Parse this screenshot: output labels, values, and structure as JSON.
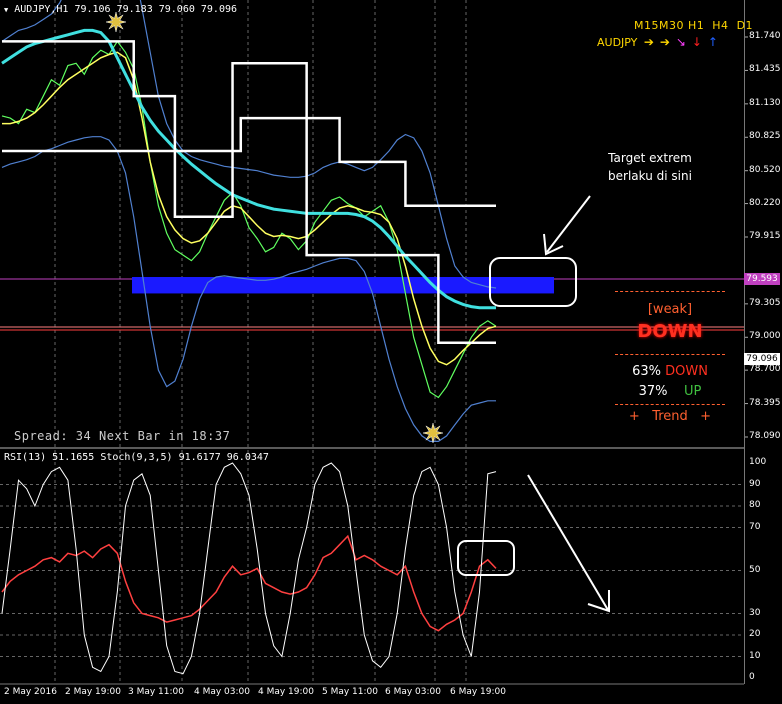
{
  "header": {
    "symbol_info": "AUDJPY,H1  79.106 79.183 79.060 79.096",
    "indicator_info": "RSI(13) 51.1655  Stoch(9,3,5) 91.6177 96.0347",
    "spread_text": "Spread: 34  Next Bar in 18:37"
  },
  "price_axis": {
    "labels": [
      "81.740",
      "81.435",
      "81.130",
      "80.825",
      "80.520",
      "80.220",
      "79.915",
      "79.305",
      "79.000",
      "78.700",
      "78.395",
      "78.090"
    ],
    "current_price": "79.096",
    "marker_price": "79.593",
    "colors": {
      "current": "#ff4040",
      "marker": "#c040c0"
    }
  },
  "rsi_axis": {
    "labels": [
      "100",
      "90",
      "80",
      "70",
      "50",
      "30",
      "20",
      "10",
      "0"
    ]
  },
  "time_axis": {
    "labels": [
      "2 May 2016",
      "2 May 19:00",
      "3 May 11:00",
      "4 May 03:00",
      "4 May 19:00",
      "5 May 11:00",
      "6 May 03:00",
      "6 May 19:00"
    ]
  },
  "timeframe_panel": {
    "timeframes": [
      "M15",
      "M30",
      "H1",
      "H4",
      "D1"
    ],
    "symbol": "AUDJPY",
    "arrows": [
      {
        "dir": "right",
        "color": "#ffd700",
        "glyph": "➔"
      },
      {
        "dir": "right",
        "color": "#ffd700",
        "glyph": "➔"
      },
      {
        "dir": "down-right",
        "color": "#ff40ff",
        "glyph": "↘"
      },
      {
        "dir": "down",
        "color": "#ff2020",
        "glyph": "↓"
      },
      {
        "dir": "up",
        "color": "#2060ff",
        "glyph": "↑"
      }
    ]
  },
  "annotation": {
    "line1": "Target extrem",
    "line2": "berlaku di sini"
  },
  "signal_panel": {
    "strength": "[weak]",
    "direction": "DOWN",
    "down_pct": "63%",
    "down_label": "DOWN",
    "up_pct": "37%",
    "up_label": "UP",
    "trend_text": "+   Trend   +",
    "colors": {
      "accent": "#ff6030",
      "down": "#ff3020",
      "up": "#40c040",
      "text": "#ffffff"
    }
  },
  "chart_data": [
    {
      "type": "line",
      "title": "AUDJPY,H1",
      "ylim": [
        78.09,
        81.74
      ],
      "series": [
        {
          "name": "price",
          "y": [
            81.02,
            81.0,
            80.95,
            81.08,
            81.05,
            81.2,
            81.35,
            81.3,
            81.48,
            81.5,
            81.4,
            81.55,
            81.62,
            81.58,
            81.7,
            81.6,
            81.45,
            81.1,
            80.6,
            80.2,
            79.95,
            79.8,
            79.75,
            79.7,
            79.78,
            79.95,
            80.1,
            80.25,
            80.32,
            80.2,
            80.0,
            79.9,
            79.78,
            79.82,
            79.95,
            79.9,
            79.8,
            79.88,
            80.05,
            80.15,
            80.25,
            80.28,
            80.22,
            80.18,
            80.1,
            80.15,
            80.2,
            80.05,
            79.8,
            79.4,
            79.0,
            78.75,
            78.5,
            78.45,
            78.55,
            78.7,
            78.85,
            79.0,
            79.1,
            79.15,
            79.1
          ]
        },
        {
          "name": "ma-yellow",
          "y": [
            80.95,
            80.95,
            80.97,
            81.0,
            81.05,
            81.12,
            81.2,
            81.28,
            81.35,
            81.4,
            81.45,
            81.5,
            81.55,
            81.58,
            81.6,
            81.55,
            81.35,
            81.0,
            80.6,
            80.3,
            80.1,
            79.98,
            79.9,
            79.86,
            79.88,
            79.95,
            80.05,
            80.15,
            80.2,
            80.18,
            80.1,
            80.02,
            79.95,
            79.92,
            79.93,
            79.92,
            79.9,
            79.92,
            79.98,
            80.05,
            80.12,
            80.18,
            80.2,
            80.18,
            80.15,
            80.14,
            80.12,
            80.05,
            79.9,
            79.65,
            79.35,
            79.1,
            78.9,
            78.78,
            78.75,
            78.8,
            78.88,
            78.95,
            79.02,
            79.08,
            79.1
          ]
        },
        {
          "name": "ma-cyan",
          "y": [
            81.5,
            81.55,
            81.6,
            81.65,
            81.68,
            81.7,
            81.72,
            81.74,
            81.76,
            81.78,
            81.8,
            81.8,
            81.78,
            81.7,
            81.55,
            81.4,
            81.25,
            81.1,
            80.98,
            80.88,
            80.8,
            80.72,
            80.65,
            80.58,
            80.52,
            80.46,
            80.4,
            80.35,
            80.3,
            80.27,
            80.24,
            80.21,
            80.19,
            80.17,
            80.16,
            80.15,
            80.14,
            80.13,
            80.13,
            80.13,
            80.13,
            80.13,
            80.13,
            80.12,
            80.1,
            80.06,
            80.0,
            79.92,
            79.83,
            79.74,
            79.66,
            79.58,
            79.5,
            79.43,
            79.37,
            79.33,
            79.3,
            79.28,
            79.27,
            79.27,
            79.27
          ]
        },
        {
          "name": "bb-upper",
          "y": [
            81.7,
            81.75,
            81.8,
            81.82,
            81.85,
            81.9,
            81.95,
            82.05,
            82.2,
            82.4,
            82.6,
            82.8,
            82.9,
            82.95,
            82.9,
            82.7,
            82.4,
            82.0,
            81.6,
            81.2,
            80.95,
            80.8,
            80.7,
            80.65,
            80.62,
            80.6,
            80.58,
            80.56,
            80.55,
            80.54,
            80.53,
            80.52,
            80.5,
            80.48,
            80.47,
            80.46,
            80.46,
            80.47,
            80.5,
            80.55,
            80.58,
            80.6,
            80.58,
            80.55,
            80.52,
            80.55,
            80.62,
            80.7,
            80.8,
            80.85,
            80.82,
            80.7,
            80.5,
            80.2,
            79.9,
            79.65,
            79.55,
            79.5,
            79.48,
            79.46,
            79.45
          ]
        },
        {
          "name": "bb-lower",
          "y": [
            80.55,
            80.58,
            80.6,
            80.62,
            80.65,
            80.7,
            80.72,
            80.75,
            80.78,
            80.8,
            80.82,
            80.83,
            80.83,
            80.8,
            80.7,
            80.5,
            80.1,
            79.6,
            79.1,
            78.7,
            78.55,
            78.6,
            78.8,
            79.1,
            79.35,
            79.5,
            79.55,
            79.56,
            79.55,
            79.54,
            79.53,
            79.52,
            79.52,
            79.53,
            79.55,
            79.58,
            79.6,
            79.62,
            79.65,
            79.68,
            79.7,
            79.72,
            79.72,
            79.7,
            79.6,
            79.4,
            79.1,
            78.8,
            78.55,
            78.35,
            78.2,
            78.1,
            78.05,
            78.05,
            78.1,
            78.2,
            78.3,
            78.38,
            78.4,
            78.42,
            78.42
          ]
        },
        {
          "name": "step-line",
          "y": [
            81.7,
            81.7,
            81.7,
            81.7,
            81.7,
            81.7,
            81.7,
            81.7,
            81.7,
            81.7,
            81.7,
            81.7,
            81.7,
            81.7,
            81.7,
            81.7,
            81.2,
            81.2,
            81.2,
            81.2,
            81.2,
            80.1,
            80.1,
            80.1,
            80.1,
            80.1,
            80.1,
            80.1,
            81.5,
            81.5,
            81.5,
            81.5,
            81.5,
            81.5,
            81.5,
            81.5,
            81.5,
            79.75,
            79.75,
            79.75,
            79.75,
            79.75,
            79.75,
            79.75,
            79.75,
            79.75,
            79.75,
            79.75,
            79.75,
            79.75,
            79.75,
            79.75,
            79.75,
            78.95,
            78.95,
            78.95,
            78.95,
            78.95,
            78.95,
            78.95,
            78.95
          ]
        },
        {
          "name": "step-line-2",
          "y": [
            80.7,
            80.7,
            80.7,
            80.7,
            80.7,
            80.7,
            80.7,
            80.7,
            80.7,
            80.7,
            80.7,
            80.7,
            80.7,
            80.7,
            80.7,
            80.7,
            80.7,
            80.7,
            80.7,
            80.7,
            80.7,
            80.7,
            80.7,
            80.7,
            80.7,
            80.7,
            80.7,
            80.7,
            80.7,
            81.0,
            81.0,
            81.0,
            81.0,
            81.0,
            81.0,
            81.0,
            81.0,
            81.0,
            81.0,
            81.0,
            81.0,
            80.6,
            80.6,
            80.6,
            80.6,
            80.6,
            80.6,
            80.6,
            80.6,
            80.2,
            80.2,
            80.2,
            80.2,
            80.2,
            80.2,
            80.2,
            80.2,
            80.2,
            80.2,
            80.2,
            80.2
          ]
        }
      ],
      "zone": {
        "y1": 79.4,
        "y2": 79.55
      }
    },
    {
      "type": "line",
      "title": "RSI(13) 51.1655  Stoch(9,3,5) 91.6177 96.0347",
      "ylim": [
        0,
        100
      ],
      "series": [
        {
          "name": "rsi",
          "y": [
            40,
            45,
            48,
            50,
            52,
            55,
            56,
            54,
            58,
            57,
            59,
            56,
            60,
            62,
            58,
            45,
            35,
            30,
            29,
            28,
            26,
            27,
            28,
            29,
            32,
            36,
            40,
            47,
            52,
            48,
            49,
            51,
            44,
            42,
            40,
            39,
            40,
            42,
            48,
            56,
            58,
            62,
            66,
            55,
            57,
            55,
            52,
            50,
            48,
            52,
            40,
            30,
            24,
            22,
            25,
            27,
            30,
            40,
            52,
            55,
            51
          ]
        },
        {
          "name": "stoch",
          "y": [
            30,
            60,
            92,
            88,
            80,
            90,
            96,
            98,
            92,
            60,
            20,
            5,
            3,
            10,
            40,
            80,
            92,
            95,
            85,
            50,
            15,
            3,
            2,
            10,
            30,
            60,
            90,
            98,
            100,
            95,
            85,
            60,
            30,
            15,
            10,
            30,
            55,
            70,
            90,
            98,
            100,
            96,
            80,
            50,
            20,
            8,
            5,
            10,
            30,
            60,
            85,
            96,
            98,
            90,
            70,
            40,
            20,
            10,
            40,
            95,
            96
          ]
        }
      ]
    }
  ]
}
